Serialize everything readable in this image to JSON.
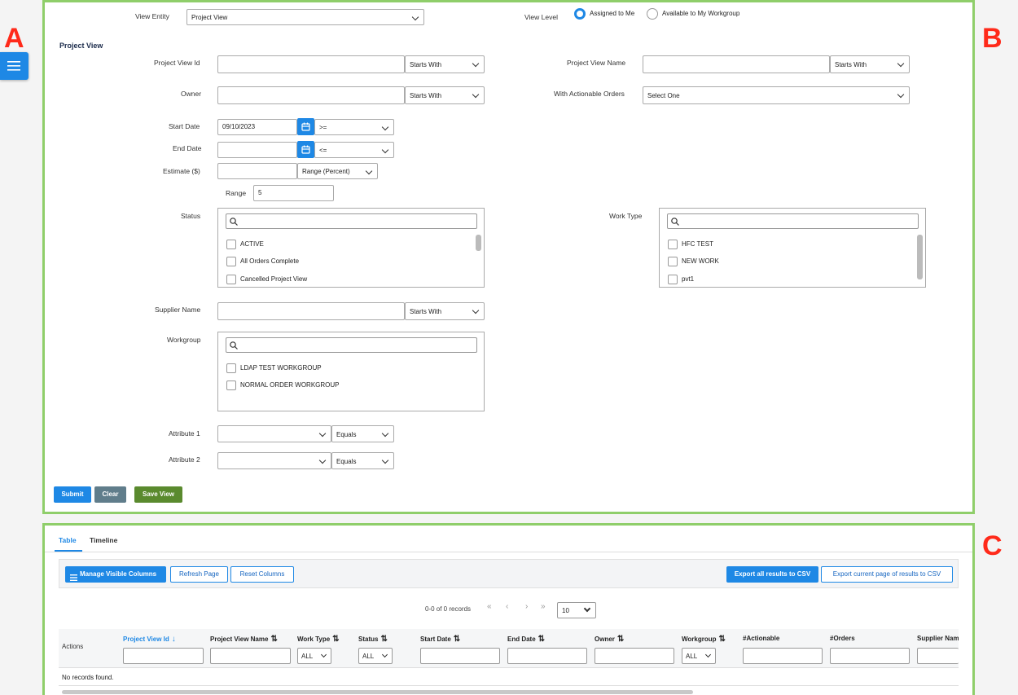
{
  "labels": {
    "a": "A",
    "b": "B",
    "c": "C"
  },
  "form": {
    "view_entity_label": "View Entity",
    "view_entity_value": "Project View",
    "view_level_label": "View Level",
    "view_level_options": [
      "Assigned to Me",
      "Available to My Workgroup"
    ],
    "view_level_selected": "Assigned to Me",
    "section_title": "Project View",
    "project_view_id_label": "Project View Id",
    "project_view_id_op": "Starts With",
    "project_view_name_label": "Project View Name",
    "project_view_name_op": "Starts With",
    "owner_label": "Owner",
    "owner_op": "Starts With",
    "actionable_label": "With Actionable Orders",
    "actionable_value": "Select One",
    "start_date_label": "Start Date",
    "start_date_value": "09/10/2023",
    "start_date_op": ">=",
    "end_date_label": "End Date",
    "end_date_value": "",
    "end_date_op": "<=",
    "estimate_label": "Estimate ($)",
    "estimate_op": "Range (Percent)",
    "range_label": "Range",
    "range_value": "5",
    "status_label": "Status",
    "status_options": [
      "ACTIVE",
      "All Orders Complete",
      "Cancelled Project View"
    ],
    "work_type_label": "Work Type",
    "work_type_options": [
      "HFC TEST",
      "NEW WORK",
      "pvt1"
    ],
    "supplier_label": "Supplier Name",
    "supplier_op": "Starts With",
    "workgroup_label": "Workgroup",
    "workgroup_options": [
      "LDAP TEST WORKGROUP",
      "NORMAL ORDER WORKGROUP"
    ],
    "attr1_label": "Attribute 1",
    "attr1_op": "Equals",
    "attr2_label": "Attribute 2",
    "attr2_op": "Equals",
    "submit": "Submit",
    "clear": "Clear",
    "save_view": "Save View"
  },
  "results": {
    "tabs": [
      "Table",
      "Timeline"
    ],
    "active_tab": "Table",
    "manage_columns": "Manage Visible Columns",
    "refresh": "Refresh Page",
    "reset_columns": "Reset Columns",
    "export_all": "Export all results to CSV",
    "export_page": "Export current page of results to CSV",
    "records": "0-0 of 0 records",
    "page_size": "10",
    "columns": {
      "actions": "Actions",
      "project_view_id": "Project View Id",
      "project_view_name": "Project View Name",
      "work_type": "Work Type",
      "status": "Status",
      "start_date": "Start Date",
      "end_date": "End Date",
      "owner": "Owner",
      "workgroup": "Workgroup",
      "actionable": "#Actionable",
      "orders": "#Orders",
      "supplier": "Supplier Nam"
    },
    "filter_all": "ALL",
    "empty": "No records found."
  },
  "colors": {
    "accent": "#1e88e5",
    "save": "#5a8a2e",
    "clear": "#607d8b",
    "panel_border": "#8fce6a",
    "section_label": "#ff2a1a"
  }
}
